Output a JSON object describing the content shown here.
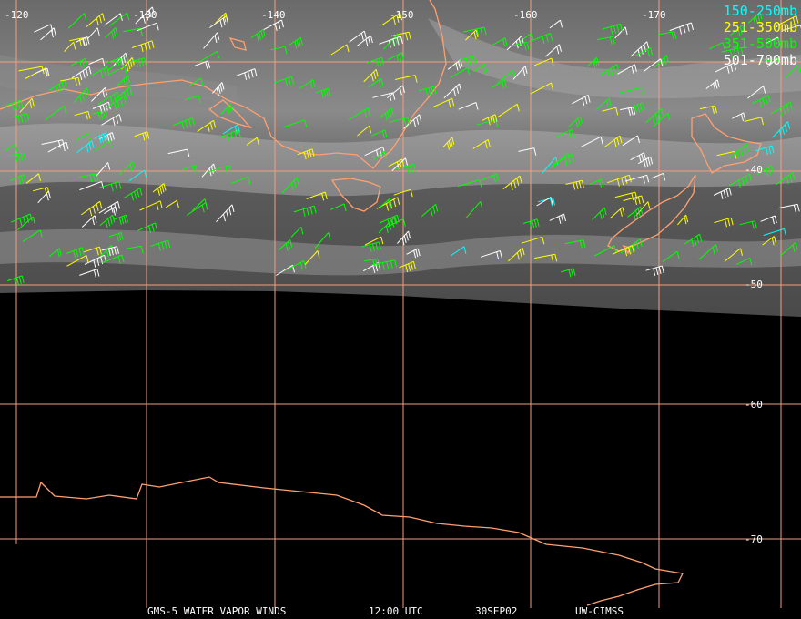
{
  "legend": [
    {
      "label": "150-250mb",
      "color": "#00ffff"
    },
    {
      "label": "251-350mb",
      "color": "#ffff00"
    },
    {
      "label": "351-500mb",
      "color": "#00ff00"
    },
    {
      "label": "501-700mb",
      "color": "#ffffff"
    }
  ],
  "longitude_labels": [
    "-120",
    "-130",
    "-140",
    "-150",
    "-160",
    "-170"
  ],
  "latitude_labels": [
    "-40",
    "-50",
    "-60",
    "-70"
  ],
  "footer": {
    "satellite": "GMS-5 WATER VAPOR WINDS",
    "time": "12:00 UTC",
    "date": "30SEP02",
    "source": "UW-CIMSS"
  },
  "colors": {
    "grid": "#f0a080",
    "coastline": "#ffa070",
    "background": "#000000"
  }
}
